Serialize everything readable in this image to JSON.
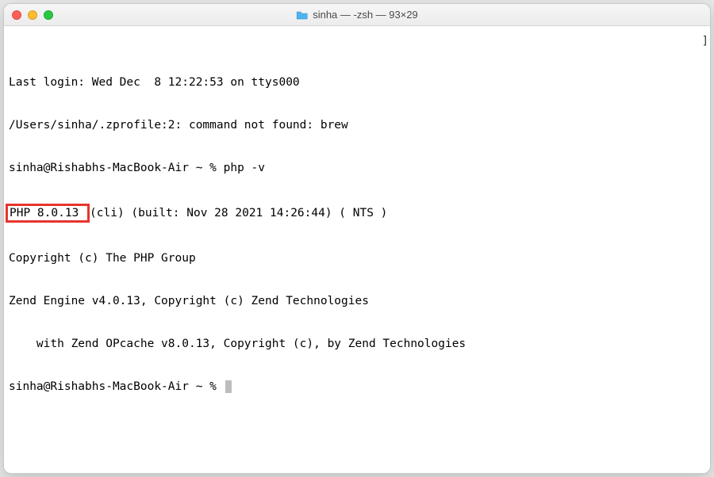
{
  "window": {
    "title": "sinha — -zsh — 93×29",
    "traffic": {
      "close": "red",
      "minimize": "yellow",
      "zoom": "green"
    },
    "folder_icon": "folder-icon"
  },
  "terminal": {
    "lines": {
      "l1": "Last login: Wed Dec  8 12:22:53 on ttys000",
      "l2": "/Users/sinha/.zprofile:2: command not found: brew",
      "l3_prompt": "sinha@Rishabhs-MacBook-Air ~ % ",
      "l3_cmd": "php -v",
      "l4_highlight": "PHP 8.0.13 ",
      "l4_rest": "(cli) (built: Nov 28 2021 14:26:44) ( NTS )",
      "l5": "Copyright (c) The PHP Group",
      "l6": "Zend Engine v4.0.13, Copyright (c) Zend Technologies",
      "l7": "    with Zend OPcache v8.0.13, Copyright (c), by Zend Technologies",
      "l8_prompt": "sinha@Rishabhs-MacBook-Air ~ % "
    },
    "scroll_marker": "]"
  },
  "colors": {
    "highlight_border": "#e7352c"
  }
}
